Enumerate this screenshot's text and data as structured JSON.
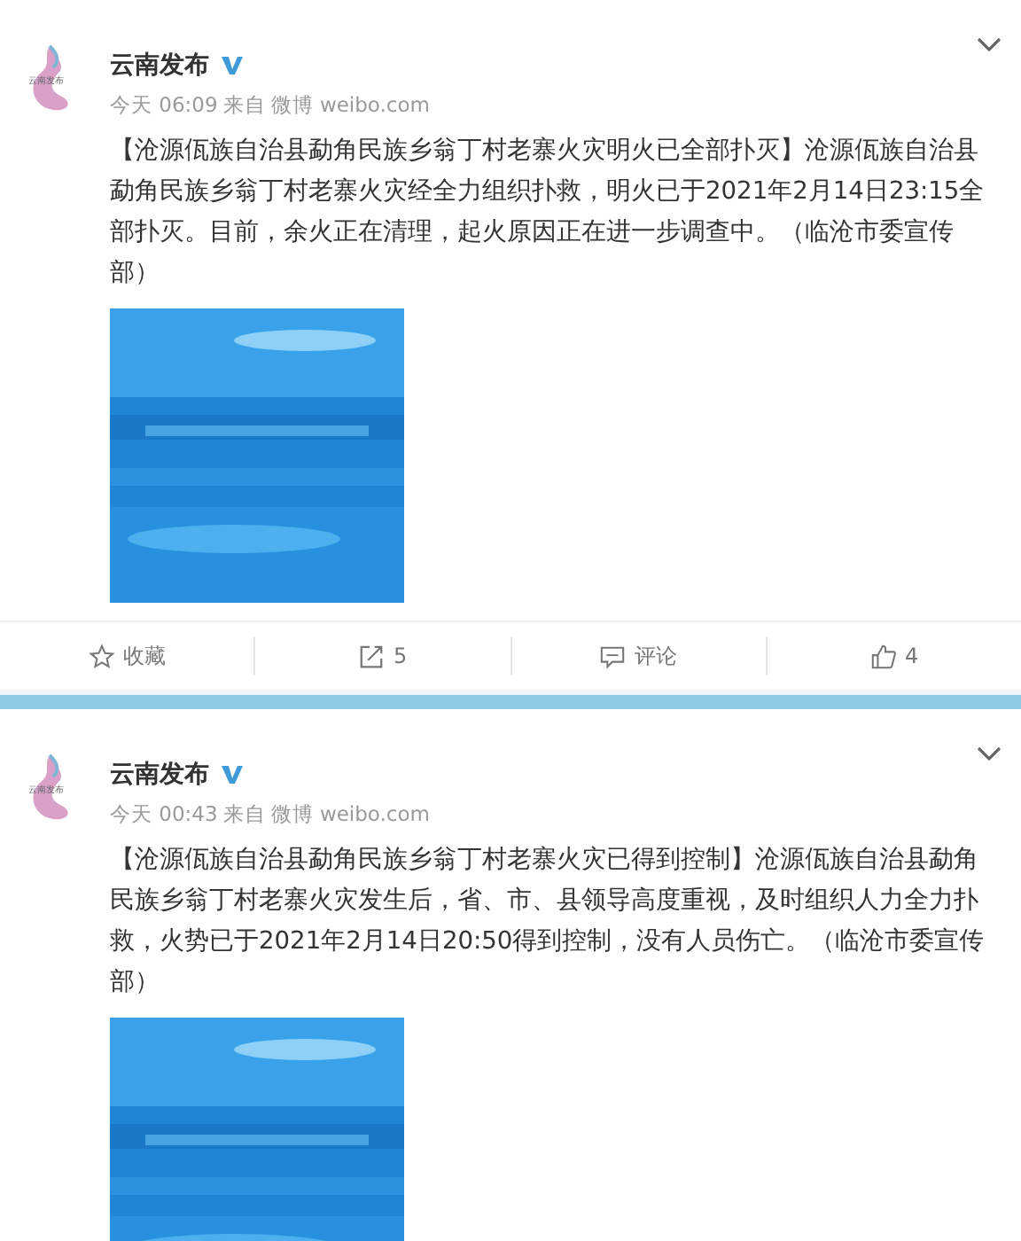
{
  "posts": [
    {
      "author": "云南发布",
      "verified": true,
      "avatar_text": "云南发布",
      "time": "今天 06:09",
      "source_prefix": "来自",
      "source": "微博 weibo.com",
      "text": "【沧源佤族自治县勐角民族乡翁丁村老寨火灾明火已全部扑灭】沧源佤族自治县勐角民族乡翁丁村老寨火灾经全力组织扑救，明火已于2021年2月14日23:15全部扑灭。目前，余火正在清理，起火原因正在进一步调查中。（临沧市委宣传部）",
      "actions": [
        {
          "kind": "favorite",
          "label": "收藏"
        },
        {
          "kind": "repost",
          "label": "5"
        },
        {
          "kind": "comment",
          "label": "评论"
        },
        {
          "kind": "like",
          "label": "4"
        }
      ]
    },
    {
      "author": "云南发布",
      "verified": true,
      "avatar_text": "云南发布",
      "time": "今天 00:43",
      "source_prefix": "来自",
      "source": "微博 weibo.com",
      "text": "【沧源佤族自治县勐角民族乡翁丁村老寨火灾已得到控制】沧源佤族自治县勐角民族乡翁丁村老寨火灾发生后，省、市、县领导高度重视，及时组织人力全力扑救，火势已于2021年2月14日20:50得到控制，没有人员伤亡。（临沧市委宣传部）"
    }
  ]
}
